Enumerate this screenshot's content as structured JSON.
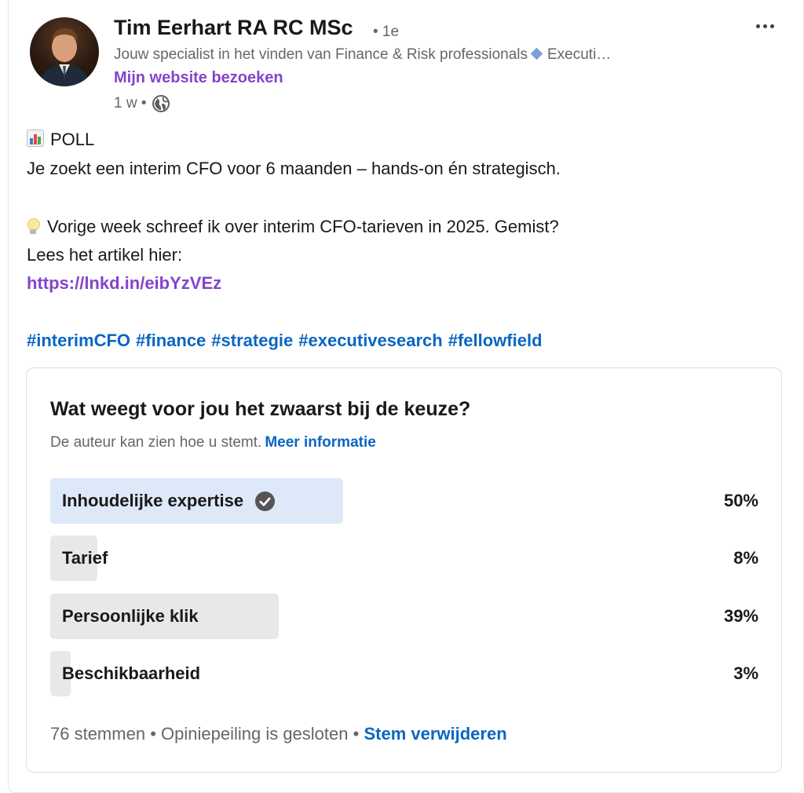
{
  "author": {
    "name": "Tim Eerhart RA RC MSc",
    "degree": "• 1e",
    "headline": "Jouw specialist in het vinden van Finance & Risk professionals",
    "headline_suffix": "Executi…",
    "website_link": "Mijn website bezoeken",
    "timestamp": "1 w •"
  },
  "post": {
    "poll_marker": "POLL",
    "line1": "Je zoekt een interim CFO voor 6 maanden – hands-on én strategisch.",
    "line2": "Vorige week schreef ik over interim CFO-tarieven in 2025. Gemist?",
    "line3": "Lees het artikel hier:",
    "link": "https://lnkd.in/eibYzVEz",
    "hashtags": [
      "#interimCFO",
      "#finance",
      "#strategie",
      "#executivesearch",
      "#fellowfield"
    ]
  },
  "poll": {
    "question": "Wat weegt voor jou het zwaarst bij de keuze?",
    "notice": "De auteur kan zien hoe u stemt.",
    "notice_link": "Meer informatie",
    "options": [
      {
        "label": "Inhoudelijke expertise",
        "percent": "50%",
        "share": 0.5,
        "selected": true
      },
      {
        "label": "Tarief",
        "percent": "8%",
        "share": 0.08,
        "selected": false
      },
      {
        "label": "Persoonlijke klik",
        "percent": "39%",
        "share": 0.39,
        "selected": false
      },
      {
        "label": "Beschikbaarheid",
        "percent": "3%",
        "share": 0.03,
        "selected": false
      }
    ],
    "votes": "76 stemmen",
    "status": "Opiniepeiling is gesloten",
    "separator": "•",
    "remove_vote": "Stem verwijderen"
  },
  "colors": {
    "link_purple": "#8344cc",
    "link_blue": "#0a66c2",
    "selected_fill": "#dde8f8",
    "option_fill": "#e8e8e8"
  }
}
